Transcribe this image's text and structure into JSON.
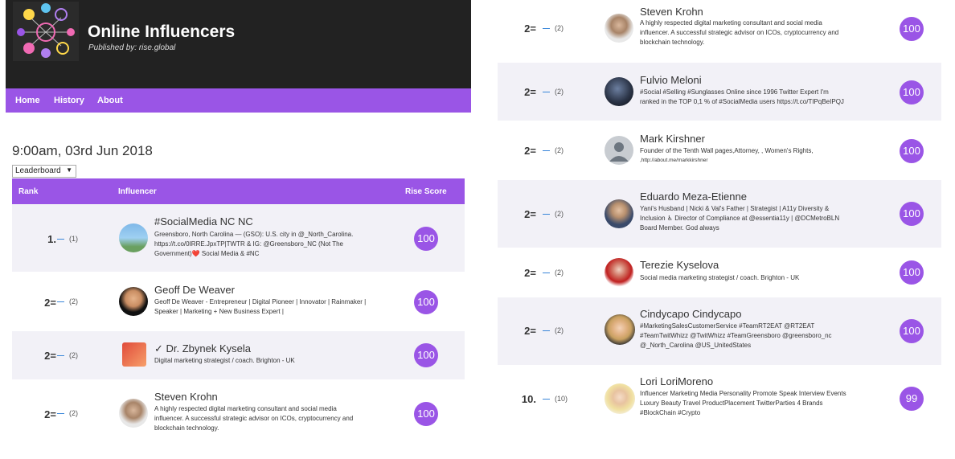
{
  "header": {
    "title": "Online Influencers",
    "subtitle": "Published by: rise.global"
  },
  "nav": [
    "Home",
    "History",
    "About"
  ],
  "timestamp": "9:00am, 03rd Jun 2018",
  "view_select": "Leaderboard",
  "table_headers": {
    "rank": "Rank",
    "influencer": "Influencer",
    "score": "Rise Score"
  },
  "left_rows": [
    {
      "rank": "1.",
      "change": "(1)",
      "name": "#SocialMedia NC NC",
      "desc_lines": [
        "Greensboro, North Carolina — (GSO): U.S. city in @_North_Carolina.",
        "https://t.co/0IRRE.JpxTP|TWTR & IG: @Greensboro_NC (Not The",
        "Government)❤️ Social Media & #NC"
      ],
      "score": "100"
    },
    {
      "rank": "2=",
      "change": "(2)",
      "name": "Geoff De Weaver",
      "desc_lines": [
        "Geoff De Weaver - Entrepreneur | Digital Pioneer | Innovator | Rainmaker |",
        "Speaker | Marketing + New Business Expert |"
      ],
      "score": "100"
    },
    {
      "rank": "2=",
      "change": "(2)",
      "name": "✓ Dr. Zbynek Kysela",
      "desc_lines": [
        "Digital marketing strategist / coach. Brighton - UK"
      ],
      "score": "100"
    },
    {
      "rank": "2=",
      "change": "(2)",
      "name": "Steven Krohn",
      "desc_lines": [
        "A highly respected digital marketing consultant and social media",
        "influencer. A successful strategic advisor on ICOs, cryptocurrency and",
        "blockchain technology."
      ],
      "score": "100"
    }
  ],
  "right_rows": [
    {
      "rank": "2=",
      "change": "(2)",
      "name": "Steven Krohn",
      "desc_lines": [
        "A highly respected digital marketing consultant and social media",
        "influencer. A successful strategic advisor on ICOs, cryptocurrency and",
        "blockchain technology."
      ],
      "score": "100"
    },
    {
      "rank": "2=",
      "change": "(2)",
      "name": "Fulvio Meloni",
      "desc_lines": [
        "#Social #Selling #Sunglasses Online since 1996 Twitter Expert I'm",
        "ranked in the TOP 0,1 % of #SocialMedia users https://t.co/TIPqBeIPQJ"
      ],
      "score": "100"
    },
    {
      "rank": "2=",
      "change": "(2)",
      "name": "Mark Kirshner",
      "desc_lines": [
        "Founder of the Tenth Wall pages,Attorney, , Women's Rights,",
        ",http://about.me/markkirshner"
      ],
      "score": "100"
    },
    {
      "rank": "2=",
      "change": "(2)",
      "name": "Eduardo Meza-Etienne",
      "desc_lines": [
        "Yani's Husband | Nicki & Val's Father | Strategist | A11y Diversity &",
        "Inclusion ♿ Director of Compliance at @essentia11y | @DCMetroBLN",
        "Board Member. God always"
      ],
      "score": "100"
    },
    {
      "rank": "2=",
      "change": "(2)",
      "name": "Terezie Kyselova",
      "desc_lines": [
        "Social media marketing strategist / coach. Brighton - UK"
      ],
      "score": "100"
    },
    {
      "rank": "2=",
      "change": "(2)",
      "name": "Cindycapo Cindycapo",
      "desc_lines": [
        "#MarketingSalesCustomerService #TeamRT2EAT @RT2EAT",
        "#TeamTwitWhizz @TwitWhizz #TeamGreensboro @greensboro_nc",
        "@_North_Carolina @US_UnitedStates"
      ],
      "score": "100"
    },
    {
      "rank": "10.",
      "change": "(10)",
      "name": "Lori LoriMoreno",
      "desc_lines": [
        "Influencer Marketing Media Personality Promote Speak Interview Events",
        "Luxury Beauty Travel ProductPlacement TwitterParties 4 Brands",
        "#BlockChain #Crypto"
      ],
      "score": "99"
    }
  ],
  "colors": {
    "accent": "#9a55e6",
    "header_bg": "#222222",
    "row_alt": "#f2f1f7",
    "change_dash": "#2a7dd6"
  }
}
